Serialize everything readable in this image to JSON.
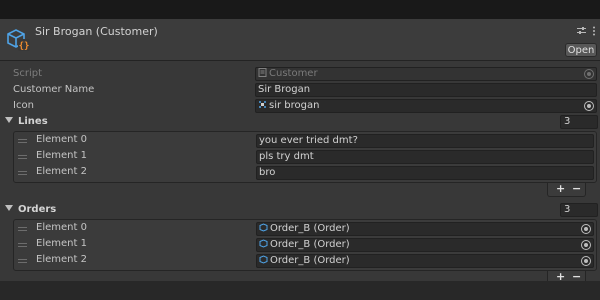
{
  "header": {
    "title": "Sir Brogan (Customer)",
    "open_label": "Open",
    "asset_icon": "scriptable-object-icon",
    "settings_icon": "sliders-icon",
    "menu_icon": "kebab-menu-icon"
  },
  "properties": [
    {
      "label": "Script",
      "value": "Customer",
      "icon": "script-icon",
      "disabled": true
    },
    {
      "label": "Customer Name",
      "value": "Sir Brogan"
    },
    {
      "label": "Icon",
      "value": "sir brogan",
      "icon": "sprite-icon"
    }
  ],
  "lines": {
    "label": "Lines",
    "count": "3",
    "elements": [
      {
        "label": "Element 0",
        "value": "you ever tried dmt?"
      },
      {
        "label": "Element 1",
        "value": "pls try dmt"
      },
      {
        "label": "Element 2",
        "value": "bro"
      }
    ],
    "add_label": "+",
    "remove_label": "−"
  },
  "orders": {
    "label": "Orders",
    "count": "3",
    "elements": [
      {
        "label": "Element 0",
        "value": "Order_B (Order)"
      },
      {
        "label": "Element 1",
        "value": "Order_B (Order)"
      },
      {
        "label": "Element 2",
        "value": "Order_B (Order)"
      }
    ],
    "add_label": "+",
    "remove_label": "−"
  },
  "colors": {
    "background": "#383838",
    "field": "#2a2a2a",
    "text": "#c4c4c4",
    "icon_blue": "#4fa3e6",
    "icon_orange": "#f08c2e"
  }
}
